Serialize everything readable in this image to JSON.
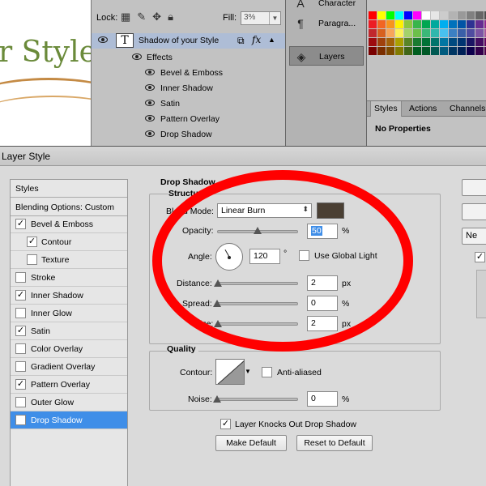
{
  "canvas": {
    "title_fragment": "r Style"
  },
  "layers_panel": {
    "lock_label": "Lock:",
    "fill_label": "Fill:",
    "fill_value": "3%",
    "layer_name": "Shadow of your Style",
    "layer_thumb": "T",
    "fx_label": "fx",
    "effects_label": "Effects",
    "effects": [
      "Bevel & Emboss",
      "Inner Shadow",
      "Satin",
      "Pattern Overlay",
      "Drop Shadow"
    ]
  },
  "mid_panel": {
    "items": [
      {
        "label": "Character",
        "icon": "A"
      },
      {
        "label": "Paragra...",
        "icon": "¶"
      },
      {
        "label": "Layers",
        "icon": "◈"
      }
    ]
  },
  "right_panel": {
    "swatches": [
      "#ff0000",
      "#ffff00",
      "#00ff00",
      "#00ffff",
      "#0000ff",
      "#ff00ff",
      "#ffffff",
      "#e6e6e6",
      "#cccccc",
      "#b3b3b3",
      "#999999",
      "#808080",
      "#666666",
      "#4d4d4d",
      "#ed1c24",
      "#f26522",
      "#f7941d",
      "#fff200",
      "#8dc63f",
      "#39b54a",
      "#00a651",
      "#00a99d",
      "#00aeef",
      "#0072bc",
      "#0054a6",
      "#2e3192",
      "#662d91",
      "#92278f",
      "#c1272d",
      "#d7601f",
      "#f7a55b",
      "#fbf15c",
      "#a3d26b",
      "#6cc04a",
      "#3ab878",
      "#2fb7ad",
      "#48c1ef",
      "#3b80c3",
      "#3a5fa8",
      "#4f4ca0",
      "#7c55a4",
      "#a9569c",
      "#9e0b0f",
      "#a0410d",
      "#a3620a",
      "#aba000",
      "#598527",
      "#1a7b30",
      "#007236",
      "#00746b",
      "#0076a3",
      "#004a80",
      "#003471",
      "#1b1464",
      "#440e62",
      "#630460",
      "#790000",
      "#7b2e00",
      "#7d4900",
      "#827b00",
      "#406618",
      "#005e20",
      "#005826",
      "#005952",
      "#005b7f",
      "#003663",
      "#002157",
      "#0d004c",
      "#32004b",
      "#4b0049"
    ],
    "tabs": [
      "Styles",
      "Actions",
      "Channels"
    ],
    "no_properties": "No Properties"
  },
  "dialog": {
    "title": "Layer Style",
    "styles_header": "Styles",
    "blending_options": "Blending Options: Custom",
    "style_items": [
      {
        "label": "Bevel & Emboss",
        "checked": true,
        "indent": false,
        "active": false
      },
      {
        "label": "Contour",
        "checked": true,
        "indent": true,
        "active": false
      },
      {
        "label": "Texture",
        "checked": false,
        "indent": true,
        "active": false
      },
      {
        "label": "Stroke",
        "checked": false,
        "indent": false,
        "active": false
      },
      {
        "label": "Inner Shadow",
        "checked": true,
        "indent": false,
        "active": false
      },
      {
        "label": "Inner Glow",
        "checked": false,
        "indent": false,
        "active": false
      },
      {
        "label": "Satin",
        "checked": true,
        "indent": false,
        "active": false
      },
      {
        "label": "Color Overlay",
        "checked": false,
        "indent": false,
        "active": false
      },
      {
        "label": "Gradient Overlay",
        "checked": false,
        "indent": false,
        "active": false
      },
      {
        "label": "Pattern Overlay",
        "checked": true,
        "indent": false,
        "active": false
      },
      {
        "label": "Outer Glow",
        "checked": false,
        "indent": false,
        "active": false
      },
      {
        "label": "Drop Shadow",
        "checked": true,
        "indent": false,
        "active": true
      }
    ],
    "section_title": "Drop Shadow",
    "structure_title": "Structure",
    "blend_mode_label": "Blend Mode:",
    "blend_mode_value": "Linear Burn",
    "shadow_color": "#4a3f33",
    "opacity_label": "Opacity:",
    "opacity_value": "50",
    "opacity_fraction": 0.5,
    "percent": "%",
    "angle_label": "Angle:",
    "angle_value": "120",
    "degree": "°",
    "global_light_label": "Use Global Light",
    "global_light_checked": false,
    "distance_label": "Distance:",
    "distance_value": "2",
    "px": "px",
    "spread_label": "Spread:",
    "spread_value": "0",
    "size_label": "Size:",
    "size_value": "2",
    "quality_title": "Quality",
    "contour_label": "Contour:",
    "anti_aliased_label": "Anti-aliased",
    "anti_aliased_checked": false,
    "noise_label": "Noise:",
    "noise_value": "0",
    "knockout_label": "Layer Knocks Out Drop Shadow",
    "knockout_checked": true,
    "make_default": "Make Default",
    "reset_default": "Reset to Default",
    "side_button_fragment": "Ne",
    "check_mark": "✓"
  },
  "annotation_color": "#ff0000"
}
